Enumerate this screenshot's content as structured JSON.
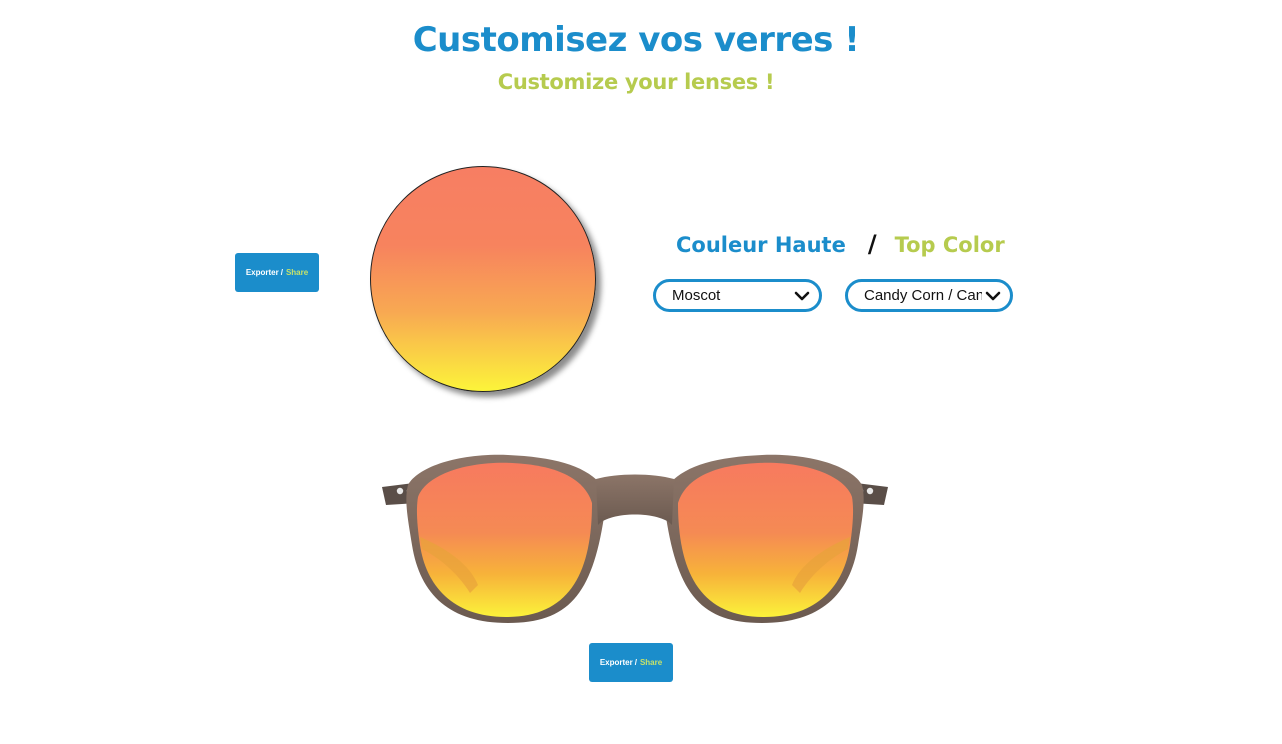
{
  "header": {
    "title_fr": "Customisez vos verres !",
    "title_en": "Customize your lenses !"
  },
  "share_button": {
    "label_fr": "Exporter",
    "separator": "/",
    "label_en": "Share"
  },
  "color_section": {
    "heading_fr": "Couleur Haute",
    "separator": "/",
    "heading_en": "Top Color"
  },
  "brand_select": {
    "selected": "Moscot"
  },
  "color_select": {
    "selected": "Candy Corn / Can"
  },
  "colors": {
    "accent_blue": "#1b8dcb",
    "accent_green": "#b6cb4e",
    "gradient_top": "#f77e63",
    "gradient_bottom": "#fcf43a",
    "frame": "#7b6459"
  },
  "icons": {
    "dropdown": "chevron-down-icon"
  }
}
